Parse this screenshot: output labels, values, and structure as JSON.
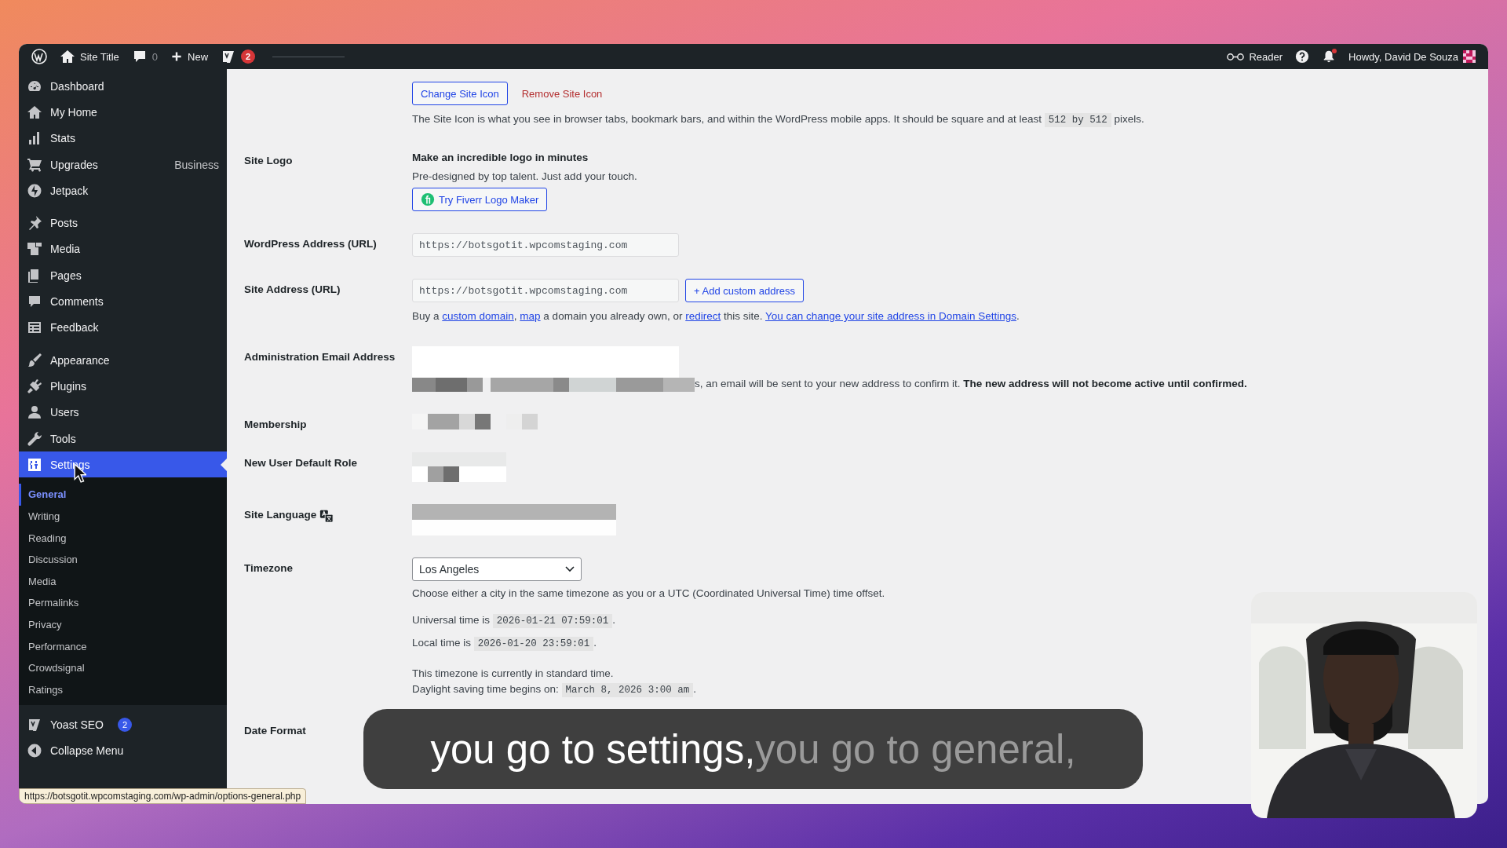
{
  "admin_bar": {
    "site_title": "Site Title",
    "comments_count": "0",
    "new_label": "New",
    "yoast_badge": "2",
    "reader_label": "Reader",
    "notifications_unread": true,
    "account_label": "Howdy, David De Souza"
  },
  "sidebar": {
    "groups": [
      {
        "items": [
          {
            "label": "Dashboard",
            "selected": false
          },
          {
            "label": "My Home",
            "selected": false
          },
          {
            "label": "Stats",
            "selected": false
          },
          {
            "label": "Upgrades",
            "selected": false,
            "note": "Business"
          },
          {
            "label": "Jetpack",
            "selected": false
          }
        ]
      },
      {
        "items": [
          {
            "label": "Posts",
            "selected": false
          },
          {
            "label": "Media",
            "selected": false
          },
          {
            "label": "Pages",
            "selected": false
          },
          {
            "label": "Comments",
            "selected": false
          },
          {
            "label": "Feedback",
            "selected": false
          }
        ]
      },
      {
        "items": [
          {
            "label": "Appearance",
            "selected": false
          },
          {
            "label": "Plugins",
            "selected": false
          },
          {
            "label": "Users",
            "selected": false
          },
          {
            "label": "Tools",
            "selected": false
          },
          {
            "label": "Settings",
            "selected": true,
            "children": [
              {
                "label": "General",
                "selected": true
              },
              {
                "label": "Writing",
                "selected": false
              },
              {
                "label": "Reading",
                "selected": false
              },
              {
                "label": "Discussion",
                "selected": false
              },
              {
                "label": "Media",
                "selected": false
              },
              {
                "label": "Permalinks",
                "selected": false
              },
              {
                "label": "Privacy",
                "selected": false
              },
              {
                "label": "Performance",
                "selected": false
              },
              {
                "label": "Crowdsignal",
                "selected": false
              },
              {
                "label": "Ratings",
                "selected": false
              }
            ]
          }
        ]
      },
      {
        "items": [
          {
            "label": "Yoast SEO",
            "selected": false,
            "badge": "2"
          },
          {
            "label": "Collapse Menu",
            "selected": false
          }
        ]
      }
    ]
  },
  "settings": [
    {
      "kind": "site_icon",
      "buttons": [
        {
          "kind": "secondary",
          "label": "Change Site Icon"
        },
        {
          "kind": "danger_link",
          "label": "Remove Site Icon"
        }
      ],
      "paragraphs": [
        [
          {
            "kind": "text",
            "text": "The Site Icon is what you see in browser tabs, bookmark bars, and within the WordPress mobile apps. It should be square and at least "
          },
          {
            "kind": "code",
            "text": "512 by 512"
          },
          {
            "kind": "text",
            "text": " pixels."
          }
        ]
      ]
    },
    {
      "kind": "promo",
      "label": "Site Logo",
      "heading": "Make an incredible logo in minutes",
      "text": "Pre-designed by top talent. Just add your touch.",
      "button": "Try Fiverr Logo Maker"
    },
    {
      "kind": "field",
      "label": "WordPress Address (URL)",
      "value": "https://botsgotit.wpcomstaging.com",
      "disabled": true
    },
    {
      "kind": "field",
      "label": "Site Address (URL)",
      "value": "https://botsgotit.wpcomstaging.com",
      "disabled": true,
      "button": "+ Add custom address",
      "paragraphs": [
        [
          {
            "kind": "text",
            "text": "Buy a "
          },
          {
            "kind": "link",
            "text": "custom domain"
          },
          {
            "kind": "text",
            "text": ", "
          },
          {
            "kind": "link",
            "text": "map"
          },
          {
            "kind": "text",
            "text": " a domain you already own, or "
          },
          {
            "kind": "link",
            "text": "redirect"
          },
          {
            "kind": "text",
            "text": " this site. "
          },
          {
            "kind": "link",
            "text": "You can change your site address in Domain Settings"
          },
          {
            "kind": "text",
            "text": "."
          }
        ]
      ]
    },
    {
      "kind": "redacted",
      "label": "Administration Email Address",
      "paragraphs": [
        [
          {
            "kind": "text",
            "text": "s, an email will be sent to your new address to confirm it. "
          },
          {
            "kind": "bold",
            "text": "The new address will not become active until confirmed."
          }
        ]
      ]
    },
    {
      "kind": "redacted",
      "label": "Membership"
    },
    {
      "kind": "redacted",
      "label": "New User Default Role"
    },
    {
      "kind": "language",
      "label": "Site Language"
    },
    {
      "kind": "select",
      "label": "Timezone",
      "value": "Los Angeles",
      "paragraphs": [
        [
          {
            "kind": "text",
            "text": "Choose either a city in the same timezone as you or a UTC (Coordinated Universal Time) time offset."
          }
        ],
        [
          {
            "kind": "text",
            "text": "Universal time is "
          },
          {
            "kind": "code",
            "text": "2026-01-21 07:59:01"
          },
          {
            "kind": "text",
            "text": "."
          }
        ],
        [
          {
            "kind": "text",
            "text": "Local time is "
          },
          {
            "kind": "code",
            "text": "2026-01-20 23:59:01"
          },
          {
            "kind": "text",
            "text": "."
          }
        ],
        [
          {
            "kind": "text",
            "text": "This timezone is currently in standard time."
          }
        ],
        [
          {
            "kind": "text",
            "text": "Daylight saving time begins on: "
          },
          {
            "kind": "code",
            "text": "March 8, 2026 3:00 am"
          },
          {
            "kind": "text",
            "text": "."
          }
        ]
      ]
    },
    {
      "kind": "radios",
      "label": "Date Format"
    }
  ],
  "status_url": "https://botsgotit.wpcomstaging.com/wp-admin/options-general.php",
  "caption": {
    "spoken": "you go to settings,",
    "upcoming": "you go to general,"
  }
}
